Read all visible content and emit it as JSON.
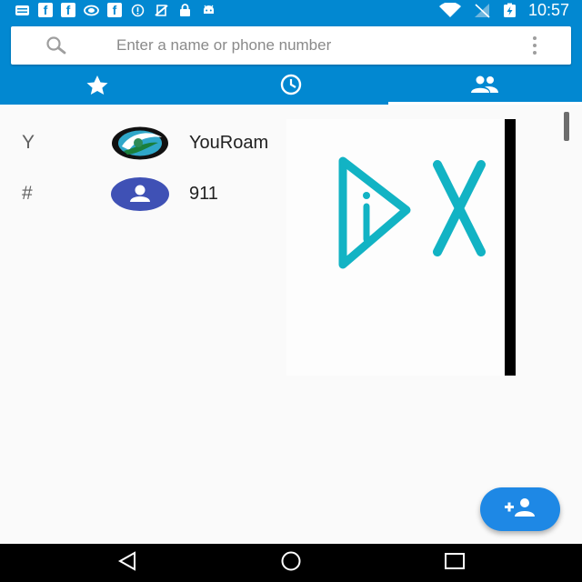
{
  "status_bar": {
    "time": "10:57",
    "fb_letter": "f",
    "left_icons": [
      "message-icon",
      "facebook-icon",
      "facebook-icon",
      "nvidia-icon",
      "facebook-icon",
      "info-icon",
      "no-sim-icon",
      "lock-icon",
      "android-icon"
    ],
    "right_icons": [
      "wifi-icon",
      "no-signal-icon",
      "battery-charging-icon"
    ]
  },
  "search": {
    "placeholder": "Enter a name or phone number"
  },
  "tabs": [
    {
      "name": "favorites",
      "icon": "star-icon",
      "active": false
    },
    {
      "name": "recents",
      "icon": "clock-icon",
      "active": false
    },
    {
      "name": "contacts",
      "icon": "people-icon",
      "active": true
    }
  ],
  "contacts": [
    {
      "section": "Y",
      "name": "YouRoam",
      "avatar": "youroam-logo"
    },
    {
      "section": "#",
      "name": "911",
      "avatar": "person-avatar"
    }
  ],
  "ad_overlay": {
    "glyphs": "DX"
  },
  "colors": {
    "primary": "#0288d1",
    "fab": "#1e88e5",
    "avatar_default": "#3f51b5",
    "ad_glyph": "#12b3c4"
  },
  "fab": {
    "icon": "add-contact-icon"
  },
  "nav": [
    "back-icon",
    "home-icon",
    "recents-icon"
  ]
}
